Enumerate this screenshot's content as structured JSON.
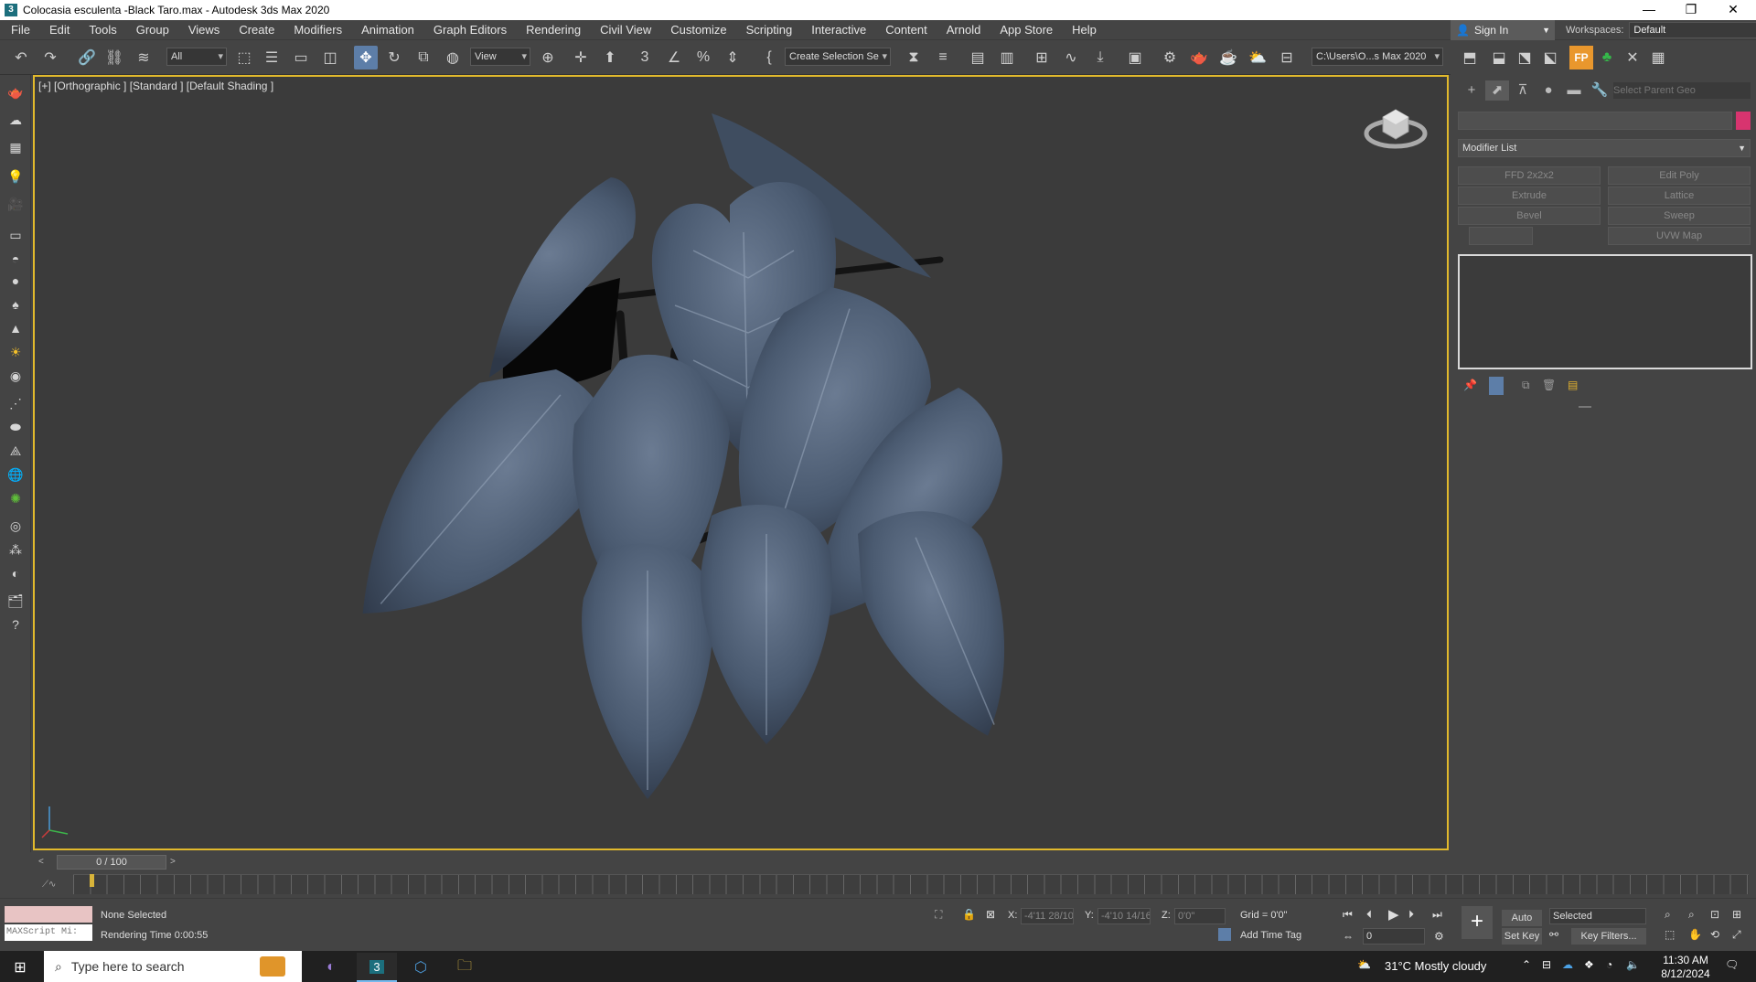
{
  "window": {
    "title": "Colocasia esculenta -Black Taro.max - Autodesk 3ds Max 2020",
    "app_icon": "3",
    "minimize": "—",
    "restore": "❐",
    "close": "✕"
  },
  "menu": [
    "File",
    "Edit",
    "Tools",
    "Group",
    "Views",
    "Create",
    "Modifiers",
    "Animation",
    "Graph Editors",
    "Rendering",
    "Civil View",
    "Customize",
    "Scripting",
    "Interactive",
    "Content",
    "Arnold",
    "App Store",
    "Help"
  ],
  "account": {
    "signin_label": "Sign In",
    "workspaces_label": "Workspaces:",
    "workspace_value": "Default"
  },
  "toolbar": {
    "selection_filter": "All",
    "ref_coord": "View",
    "named_selection": "Create Selection Se",
    "project_path": "C:\\Users\\O...s Max 2020"
  },
  "viewport": {
    "label": "[+] [Orthographic ] [Standard ] [Default Shading ]",
    "leaf_color": "#4a5a70",
    "vein_color": "#9aa9bd",
    "stem_color": "#141414"
  },
  "command_panel": {
    "search_placeholder": "Select Parent Geo",
    "modifier_list_label": "Modifier List",
    "modifier_buttons": [
      "FFD 2x2x2",
      "Edit Poly",
      "Extrude",
      "Lattice",
      "Bevel",
      "Sweep",
      "",
      "UVW Map"
    ],
    "swatch_color": "#d8346f"
  },
  "timeline": {
    "frame_counter": "0 / 100",
    "ticks_start": 0,
    "ticks_end": 100
  },
  "status": {
    "maxscript_label": "MAXScript Mi:",
    "selection_text": "None Selected",
    "rendering_time": "Rendering Time  0:00:55",
    "x_label": "X:",
    "x_value": "-4'11 28/10",
    "y_label": "Y:",
    "y_value": "-4'10 14/16",
    "z_label": "Z:",
    "z_value": "0'0\"",
    "grid": "Grid = 0'0\"",
    "add_time_tag": "Add Time Tag",
    "auto_key": "Auto Key",
    "set_key": "Set Key",
    "key_mode": "Selected",
    "key_filters": "Key Filters...",
    "current_frame": "0"
  },
  "taskbar": {
    "search_placeholder": "Type here to search",
    "weather": "31°C  Mostly cloudy",
    "time": "11:30 AM",
    "date": "8/12/2024"
  }
}
